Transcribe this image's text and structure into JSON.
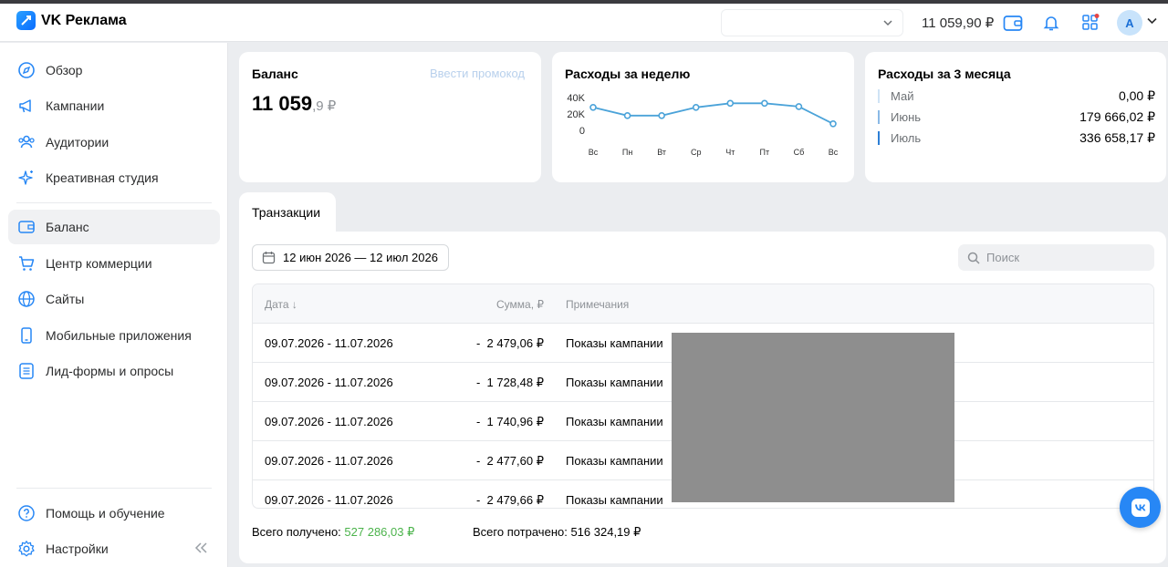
{
  "app": {
    "title": "VK Реклама"
  },
  "header": {
    "balance": "11 059,90 ₽",
    "avatar_letter": "A"
  },
  "sidebar": {
    "items": [
      {
        "label": "Обзор",
        "icon": "compass-icon"
      },
      {
        "label": "Кампании",
        "icon": "megaphone-icon"
      },
      {
        "label": "Аудитории",
        "icon": "users-icon"
      },
      {
        "label": "Креативная студия",
        "icon": "sparkle-icon"
      },
      {
        "label": "Баланс",
        "icon": "wallet-icon",
        "active": true
      },
      {
        "label": "Центр коммерции",
        "icon": "cart-icon"
      },
      {
        "label": "Сайты",
        "icon": "globe-icon"
      },
      {
        "label": "Мобильные приложения",
        "icon": "phone-icon"
      },
      {
        "label": "Лид-формы и опросы",
        "icon": "form-icon"
      }
    ],
    "footer": [
      {
        "label": "Помощь и обучение",
        "icon": "help-icon"
      },
      {
        "label": "Настройки",
        "icon": "gear-icon"
      }
    ]
  },
  "balance_card": {
    "title": "Баланс",
    "promo_link": "Ввести промокод",
    "amount_int": "11 059",
    "amount_frac": ",9 ₽"
  },
  "weekly_card": {
    "title": "Расходы за неделю",
    "chart_data": {
      "type": "line",
      "x": [
        "Вс",
        "Пн",
        "Вт",
        "Ср",
        "Чт",
        "Пт",
        "Сб",
        "Вс"
      ],
      "y": [
        28000,
        18000,
        18000,
        28000,
        33000,
        33000,
        29000,
        8000
      ],
      "ytick_labels": [
        "40K",
        "20K",
        "0"
      ],
      "ylim": [
        0,
        40000
      ],
      "color": "#4ba3d9"
    }
  },
  "months_card": {
    "title": "Расходы за 3 месяца",
    "rows": [
      {
        "name": "Май",
        "value": "0,00 ₽",
        "color": "#cfe3f5"
      },
      {
        "name": "Июнь",
        "value": "179 666,02 ₽",
        "color": "#8ab9e6"
      },
      {
        "name": "Июль",
        "value": "336 658,17 ₽",
        "color": "#2d7fd6"
      }
    ]
  },
  "transactions": {
    "tab_label": "Транзакции",
    "date_range": "12 июн 2026 — 12 июл 2026",
    "search_placeholder": "Поиск",
    "columns": {
      "date": "Дата ↓",
      "amount": "Сумма, ₽",
      "note": "Примечания"
    },
    "rows": [
      {
        "date": "09.07.2026 - 11.07.2026",
        "amount": "-  2 479,06 ₽",
        "note": "Показы кампании"
      },
      {
        "date": "09.07.2026 - 11.07.2026",
        "amount": "-  1 728,48 ₽",
        "note": "Показы кампании"
      },
      {
        "date": "09.07.2026 - 11.07.2026",
        "amount": "-  1 740,96 ₽",
        "note": "Показы кампании"
      },
      {
        "date": "09.07.2026 - 11.07.2026",
        "amount": "-  2 477,60 ₽",
        "note": "Показы кампании"
      },
      {
        "date": "09.07.2026 - 11.07.2026",
        "amount": "-  2 479,66 ₽",
        "note": "Показы кампании"
      }
    ],
    "total_received_label": "Всего получено: ",
    "total_received_value": "527 286,03 ₽",
    "total_spent_label": "Всего потрачено: ",
    "total_spent_value": "516 324,19 ₽"
  },
  "colors": {
    "accent": "#2787f5",
    "positive": "#4bb34b"
  }
}
